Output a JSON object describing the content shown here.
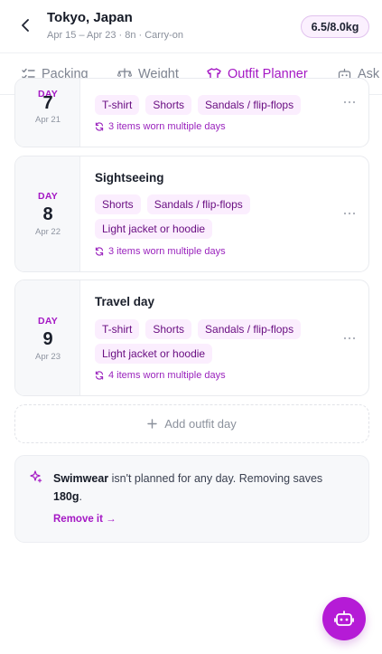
{
  "header": {
    "back_icon": "chevron-left-icon",
    "title": "Tokyo, Japan",
    "subtitle": "Apr 15 – Apr 23 · 8n · Carry-on",
    "weight": "6.5/8.0kg"
  },
  "tabs": [
    {
      "label": "Packing",
      "icon": "checklist-icon"
    },
    {
      "label": "Weight",
      "icon": "scale-icon"
    },
    {
      "label": "Outfit Planner",
      "icon": "shirt-icon",
      "active": true
    },
    {
      "label": "Ask",
      "icon": "robot-icon"
    }
  ],
  "days": [
    {
      "label": "DAY",
      "number": "7",
      "date": "Apr 21",
      "activity": "",
      "rows": [
        [
          "T-shirt",
          "Shorts",
          "Sandals / flip-flops"
        ]
      ],
      "note": "3 items worn multiple days"
    },
    {
      "label": "DAY",
      "number": "8",
      "date": "Apr 22",
      "activity": "Sightseeing",
      "rows": [
        [
          "Shorts",
          "Sandals / flip-flops"
        ],
        [
          "Light jacket or hoodie"
        ]
      ],
      "note": "3 items worn multiple days"
    },
    {
      "label": "DAY",
      "number": "9",
      "date": "Apr 23",
      "activity": "Travel day",
      "rows": [
        [
          "T-shirt",
          "Shorts",
          "Sandals / flip-flops"
        ],
        [
          "Light jacket or hoodie"
        ]
      ],
      "note": "4 items worn multiple days"
    }
  ],
  "add_day": {
    "label": "Add outfit day",
    "icon": "plus-icon"
  },
  "suggestion": {
    "icon": "sparkle-icon",
    "item": "Swimwear",
    "text": " isn't planned for any day. Removing saves ",
    "saving": "180g",
    "end": ".",
    "action": "Remove it →"
  },
  "fab": {
    "icon": "robot-icon"
  },
  "colors": {
    "accent": "#a417c4",
    "chip_bg": "#fbeefe",
    "chip_text": "#6a0f82",
    "fab": "#b51bd6"
  }
}
